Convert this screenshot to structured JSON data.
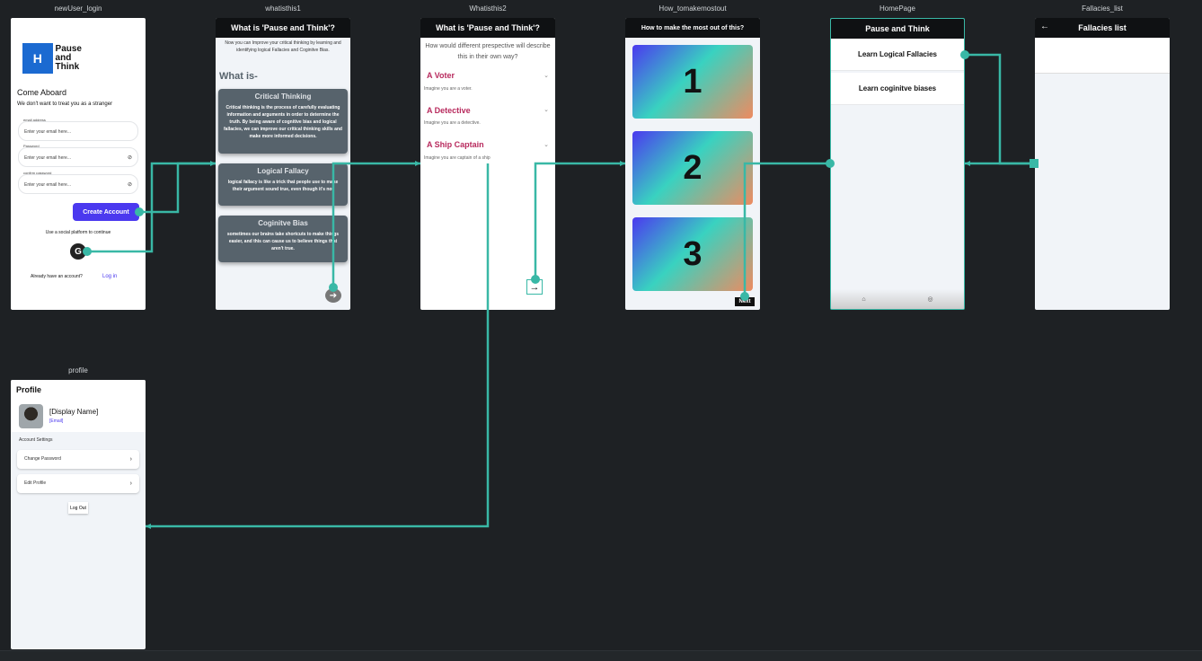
{
  "frames": {
    "login": "newUser_login",
    "what1": "whatisthis1",
    "what2": "Whatisthis2",
    "howto": "How_tomakemostout",
    "home": "HomePage",
    "fallacies": "Fallacies_list",
    "profile": "profile"
  },
  "login": {
    "logo_mark": "H",
    "logo_text_1": "Pause",
    "logo_text_2": "and",
    "logo_text_3": "Think",
    "title": "Come Aboard",
    "subtitle": "We don't want to treat you as a stranger",
    "email_label": "email address",
    "email_placeholder": "Enter your email here...",
    "password_label": "Password",
    "password_placeholder": "Enter your email here...",
    "confirm_label": "confirm password",
    "confirm_placeholder": "Enter your email here...",
    "create_button": "Create Account",
    "social_text": "Use a social platform to continue",
    "google": "G",
    "have_account": "Already have an account?",
    "login_link": "Log in"
  },
  "what1": {
    "header": "What is 'Pause and Think'?",
    "intro": "Now you can Improve your critical thinking by learning and identifying  logical Fallacies and Coginitve Bias.",
    "what_is": "What is-",
    "cards": [
      {
        "title": "Critical Thinking",
        "body": "Critical thinking is the process of carefully evaluating information and arguments in order to determine the truth. By being aware of cognitive bias and logical fallacies, we can improve our critical thinking skills and make more informed decisions."
      },
      {
        "title": "Logical Fallacy",
        "body": "logical fallacy is like a trick that people use to make their argument sound true, even though it's not"
      },
      {
        "title": "Coginitve Bias",
        "body": "sometimes our brains take shortcuts to make things easier, and this can cause us to believe things that aren't true."
      }
    ]
  },
  "what2": {
    "header": "What is 'Pause and Think'?",
    "question": "How would different prespective will describe this in their own way?",
    "roles": [
      {
        "title": "A Voter",
        "sub": "Imagine you are a voter."
      },
      {
        "title": "A Detective",
        "sub": "Imagine you are a detective."
      },
      {
        "title": "A Ship Captain",
        "sub": "Imagine you are captain of a ship"
      }
    ]
  },
  "howto": {
    "header": "How to make the most out of this?",
    "cards": [
      "1",
      "2",
      "3"
    ],
    "next": "Next"
  },
  "home": {
    "header": "Pause and Think",
    "items": [
      "Learn Logical Fallacies",
      "Learn coginitve biases"
    ]
  },
  "fallacies": {
    "header": "Fallacies list"
  },
  "profile": {
    "title": "Profile",
    "display_name": "[Display Name]",
    "email": "[Email]",
    "section": "Account Settings",
    "change_password": "Change Password",
    "edit_profile": "Edit Profile",
    "logout": "Log Out"
  },
  "colors": {
    "background": "#1e2124",
    "wire": "#39b8a6",
    "primary": "#4b39ef",
    "accent": "#b82b5e",
    "card": "#57636c"
  }
}
